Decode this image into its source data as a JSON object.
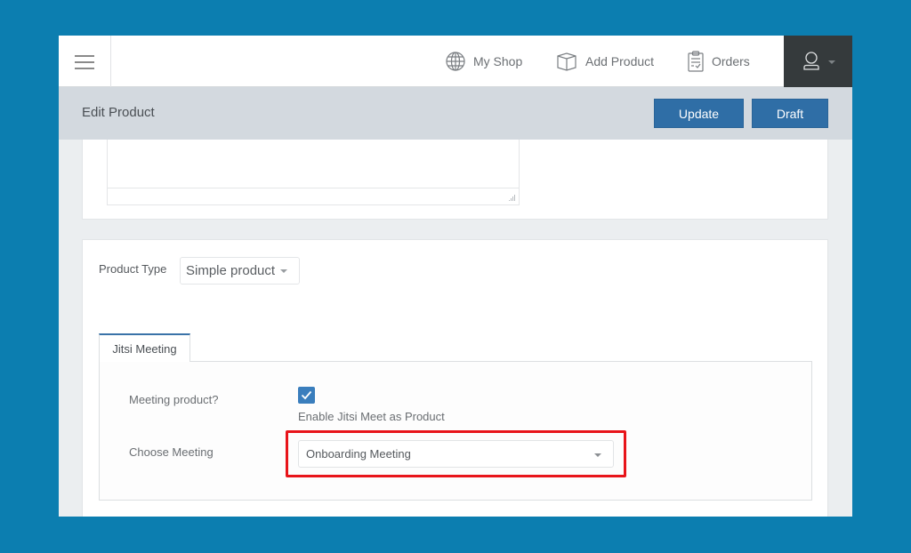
{
  "topbar": {
    "nav": [
      {
        "label": "My Shop",
        "icon": "globe-icon"
      },
      {
        "label": "Add Product",
        "icon": "box-icon"
      },
      {
        "label": "Orders",
        "icon": "clipboard-icon"
      }
    ],
    "user_icon": "user-icon"
  },
  "header": {
    "title": "Edit Product",
    "update_label": "Update",
    "draft_label": "Draft"
  },
  "product": {
    "type_label": "Product Type",
    "type_value": "Simple product"
  },
  "tabs": [
    {
      "label": "Jitsi Meeting",
      "active": true
    }
  ],
  "jitsi": {
    "meeting_product_label": "Meeting product?",
    "meeting_product_checked": true,
    "enable_desc": "Enable Jitsi Meet as Product",
    "choose_meeting_label": "Choose Meeting",
    "choose_meeting_value": "Onboarding Meeting"
  },
  "colors": {
    "background": "#0c7eb0",
    "primary_button": "#2f6ea6",
    "highlight": "#e8141a",
    "user_menu_bg": "#353a3c"
  }
}
